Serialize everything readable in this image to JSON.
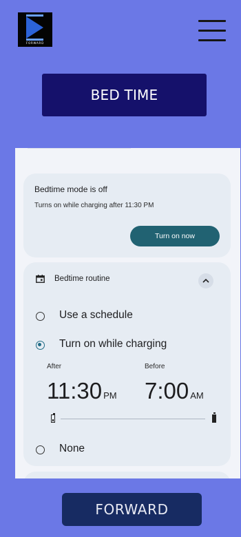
{
  "header": {
    "logo_text": "FORWARD",
    "menu_icon": "hamburger-menu-icon"
  },
  "bed_time_label": "BED TIME",
  "status_card": {
    "title": "Bedtime mode is off",
    "subtitle": "Turns on while charging after 11:30 PM",
    "button_label": "Turn on now"
  },
  "routine": {
    "icon": "calendar-icon",
    "label": "Bedtime routine",
    "collapse_icon": "chevron-up-icon",
    "options": [
      {
        "label": "Use a schedule",
        "selected": false
      },
      {
        "label": "Turn on while charging",
        "selected": true
      },
      {
        "label": "None",
        "selected": false
      }
    ],
    "after": {
      "label": "After",
      "time": "11:30",
      "ampm": "PM"
    },
    "before": {
      "label": "Before",
      "time": "7:00",
      "ampm": "AM"
    }
  },
  "forward_label": "FORWARD",
  "colors": {
    "background": "#6b78e6",
    "bed_button": "#15116b",
    "accent": "#216272",
    "forward_button": "#172b62"
  }
}
